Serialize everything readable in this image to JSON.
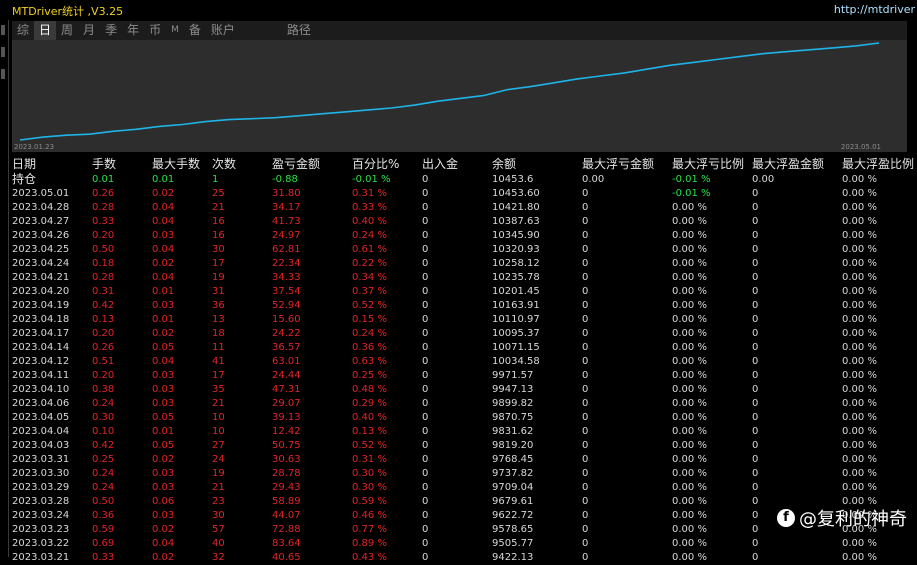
{
  "window": {
    "title": "MTDriver统计 ,V3.25",
    "url": "http://mtdriver"
  },
  "tabs": [
    "综",
    "日",
    "周",
    "月",
    "季",
    "年",
    "币",
    "M",
    "备",
    "账户",
    "路径"
  ],
  "active_tab": "日",
  "chart": {
    "start_label": "2023.01.23",
    "end_label": "2023.05.01",
    "line_color": "#1fb4e8",
    "background": "#2d2d2d",
    "equity_points": [
      0.0,
      0.03,
      0.05,
      0.06,
      0.09,
      0.11,
      0.14,
      0.16,
      0.19,
      0.21,
      0.22,
      0.23,
      0.25,
      0.27,
      0.29,
      0.31,
      0.33,
      0.36,
      0.4,
      0.43,
      0.46,
      0.52,
      0.55,
      0.59,
      0.63,
      0.66,
      0.69,
      0.73,
      0.77,
      0.8,
      0.83,
      0.86,
      0.89,
      0.91,
      0.93,
      0.95,
      0.97,
      1.0
    ]
  },
  "table": {
    "headers": [
      "日期",
      "手数",
      "最大手数",
      "次数",
      "盈亏金额",
      "百分比%",
      "出入金",
      "余额",
      "最大浮亏金额",
      "最大浮亏比例",
      "最大浮盈金额",
      "最大浮盈比例"
    ],
    "open": {
      "label": "持仓",
      "lots": "0.01",
      "max_lots": "0.01",
      "count": "1",
      "pnl": "-0.88",
      "pct": "-0.01 %",
      "deposit": "0",
      "balance": "10453.6",
      "max_float_loss": "0.00",
      "max_float_loss_pct": "-0.01 %",
      "max_float_profit": "0.00",
      "max_float_profit_pct": "0.00 %"
    },
    "rows": [
      [
        "2023.05.01",
        "0.26",
        "0.02",
        "25",
        "31.80",
        "0.31 %",
        "0",
        "10453.60",
        "0",
        "-0.01 %",
        "0",
        "0.00 %"
      ],
      [
        "2023.04.28",
        "0.28",
        "0.04",
        "21",
        "34.17",
        "0.33 %",
        "0",
        "10421.80",
        "0",
        "0.00 %",
        "0",
        "0.00 %"
      ],
      [
        "2023.04.27",
        "0.33",
        "0.04",
        "16",
        "41.73",
        "0.40 %",
        "0",
        "10387.63",
        "0",
        "0.00 %",
        "0",
        "0.00 %"
      ],
      [
        "2023.04.26",
        "0.20",
        "0.03",
        "16",
        "24.97",
        "0.24 %",
        "0",
        "10345.90",
        "0",
        "0.00 %",
        "0",
        "0.00 %"
      ],
      [
        "2023.04.25",
        "0.50",
        "0.04",
        "30",
        "62.81",
        "0.61 %",
        "0",
        "10320.93",
        "0",
        "0.00 %",
        "0",
        "0.00 %"
      ],
      [
        "2023.04.24",
        "0.18",
        "0.02",
        "17",
        "22.34",
        "0.22 %",
        "0",
        "10258.12",
        "0",
        "0.00 %",
        "0",
        "0.00 %"
      ],
      [
        "2023.04.21",
        "0.28",
        "0.04",
        "19",
        "34.33",
        "0.34 %",
        "0",
        "10235.78",
        "0",
        "0.00 %",
        "0",
        "0.00 %"
      ],
      [
        "2023.04.20",
        "0.31",
        "0.01",
        "31",
        "37.54",
        "0.37 %",
        "0",
        "10201.45",
        "0",
        "0.00 %",
        "0",
        "0.00 %"
      ],
      [
        "2023.04.19",
        "0.42",
        "0.03",
        "36",
        "52.94",
        "0.52 %",
        "0",
        "10163.91",
        "0",
        "0.00 %",
        "0",
        "0.00 %"
      ],
      [
        "2023.04.18",
        "0.13",
        "0.01",
        "13",
        "15.60",
        "0.15 %",
        "0",
        "10110.97",
        "0",
        "0.00 %",
        "0",
        "0.00 %"
      ],
      [
        "2023.04.17",
        "0.20",
        "0.02",
        "18",
        "24.22",
        "0.24 %",
        "0",
        "10095.37",
        "0",
        "0.00 %",
        "0",
        "0.00 %"
      ],
      [
        "2023.04.14",
        "0.26",
        "0.05",
        "11",
        "36.57",
        "0.36 %",
        "0",
        "10071.15",
        "0",
        "0.00 %",
        "0",
        "0.00 %"
      ],
      [
        "2023.04.12",
        "0.51",
        "0.04",
        "41",
        "63.01",
        "0.63 %",
        "0",
        "10034.58",
        "0",
        "0.00 %",
        "0",
        "0.00 %"
      ],
      [
        "2023.04.11",
        "0.20",
        "0.03",
        "17",
        "24.44",
        "0.25 %",
        "0",
        "9971.57",
        "0",
        "0.00 %",
        "0",
        "0.00 %"
      ],
      [
        "2023.04.10",
        "0.38",
        "0.03",
        "35",
        "47.31",
        "0.48 %",
        "0",
        "9947.13",
        "0",
        "0.00 %",
        "0",
        "0.00 %"
      ],
      [
        "2023.04.06",
        "0.24",
        "0.03",
        "21",
        "29.07",
        "0.29 %",
        "0",
        "9899.82",
        "0",
        "0.00 %",
        "0",
        "0.00 %"
      ],
      [
        "2023.04.05",
        "0.30",
        "0.05",
        "10",
        "39.13",
        "0.40 %",
        "0",
        "9870.75",
        "0",
        "0.00 %",
        "0",
        "0.00 %"
      ],
      [
        "2023.04.04",
        "0.10",
        "0.01",
        "10",
        "12.42",
        "0.13 %",
        "0",
        "9831.62",
        "0",
        "0.00 %",
        "0",
        "0.00 %"
      ],
      [
        "2023.04.03",
        "0.42",
        "0.05",
        "27",
        "50.75",
        "0.52 %",
        "0",
        "9819.20",
        "0",
        "0.00 %",
        "0",
        "0.00 %"
      ],
      [
        "2023.03.31",
        "0.25",
        "0.02",
        "24",
        "30.63",
        "0.31 %",
        "0",
        "9768.45",
        "0",
        "0.00 %",
        "0",
        "0.00 %"
      ],
      [
        "2023.03.30",
        "0.24",
        "0.03",
        "19",
        "28.78",
        "0.30 %",
        "0",
        "9737.82",
        "0",
        "0.00 %",
        "0",
        "0.00 %"
      ],
      [
        "2023.03.29",
        "0.24",
        "0.03",
        "21",
        "29.43",
        "0.30 %",
        "0",
        "9709.04",
        "0",
        "0.00 %",
        "0",
        "0.00 %"
      ],
      [
        "2023.03.28",
        "0.50",
        "0.06",
        "23",
        "58.89",
        "0.59 %",
        "0",
        "9679.61",
        "0",
        "0.00 %",
        "0",
        "0.00 %"
      ],
      [
        "2023.03.24",
        "0.36",
        "0.03",
        "30",
        "44.07",
        "0.46 %",
        "0",
        "9622.72",
        "0",
        "0.00 %",
        "0",
        "0.00 %"
      ],
      [
        "2023.03.23",
        "0.59",
        "0.02",
        "57",
        "72.88",
        "0.77 %",
        "0",
        "9578.65",
        "0",
        "0.00 %",
        "0",
        "0.00 %"
      ],
      [
        "2023.03.22",
        "0.69",
        "0.04",
        "40",
        "83.64",
        "0.89 %",
        "0",
        "9505.77",
        "0",
        "0.00 %",
        "0",
        "0.00 %"
      ],
      [
        "2023.03.21",
        "0.33",
        "0.02",
        "32",
        "40.65",
        "0.43 %",
        "0",
        "9422.13",
        "0",
        "0.00 %",
        "0",
        "0.00 %"
      ]
    ]
  },
  "watermark": {
    "logo": "f",
    "text": "@复利的神奇"
  }
}
